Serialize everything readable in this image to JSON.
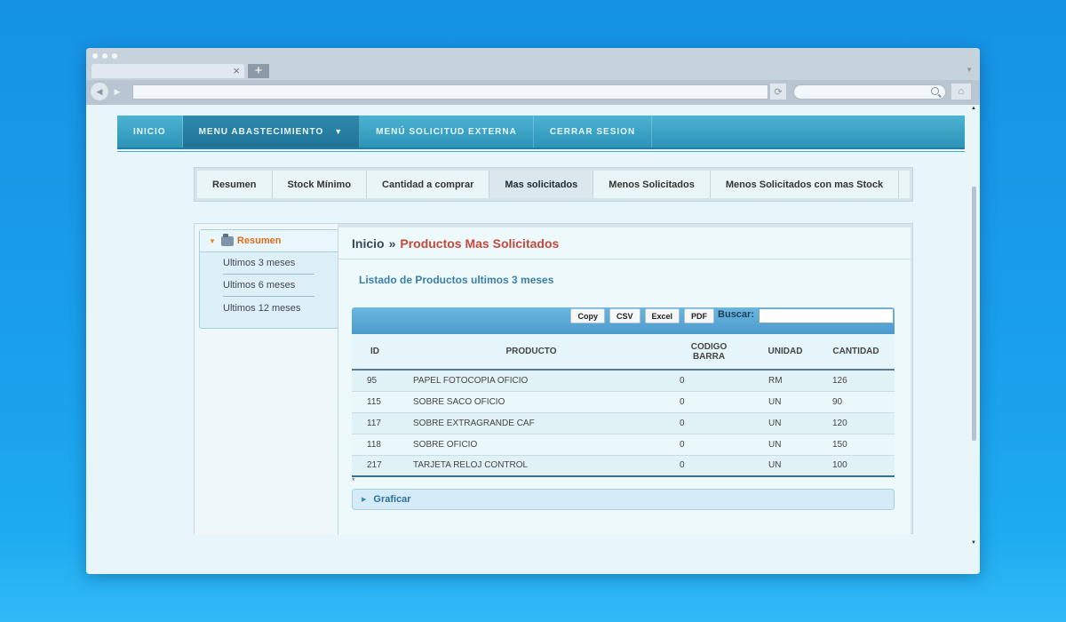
{
  "browser": {
    "tab_close": "×",
    "new_tab": "+",
    "back_glyph": "◀",
    "forward_glyph": "▶",
    "reload_glyph": "⟳",
    "home_glyph": "⌂",
    "tabs_menu_glyph": "▼"
  },
  "topnav": {
    "items": [
      {
        "label": "INICIO"
      },
      {
        "label": "MENU ABASTECIMIENTO",
        "caret": "▼",
        "active": true
      },
      {
        "label": "MENÚ SOLICITUD EXTERNA"
      },
      {
        "label": "CERRAR SESION"
      }
    ]
  },
  "subtabs": {
    "items": [
      {
        "label": "Resumen"
      },
      {
        "label": "Stock Mínimo"
      },
      {
        "label": "Cantidad a comprar"
      },
      {
        "label": "Mas solicitados",
        "active": true
      },
      {
        "label": "Menos Solicitados"
      },
      {
        "label": "Menos Solicitados con mas Stock"
      }
    ]
  },
  "sidebar": {
    "header_arrow": "▼",
    "title": "Resumen",
    "items": [
      {
        "label": "Ultimos 3 meses"
      },
      {
        "label": "Ultimos 6 meses"
      },
      {
        "label": "Ultimos 12 meses"
      }
    ]
  },
  "breadcrumb": {
    "home": "Inicio",
    "separator": "»",
    "current": "Productos Mas Solicitados"
  },
  "list_title": "Listado de Productos ultimos 3 meses",
  "table": {
    "toolbar": {
      "copy": "Copy",
      "csv": "CSV",
      "excel": "Excel",
      "pdf": "PDF",
      "search_label": "Buscar:",
      "search_value": ""
    },
    "headers": {
      "id": "ID",
      "producto": "PRODUCTO",
      "codigo_line1": "CODIGO",
      "codigo_line2": "BARRA",
      "unidad": "UNIDAD",
      "cantidad": "CANTIDAD"
    },
    "rows": [
      {
        "id": "95",
        "producto": "PAPEL FOTOCOPIA OFICIO",
        "codigo": "0",
        "unidad": "RM",
        "cantidad": "126"
      },
      {
        "id": "115",
        "producto": "SOBRE SACO OFICIO",
        "codigo": "0",
        "unidad": "UN",
        "cantidad": "90"
      },
      {
        "id": "117",
        "producto": "SOBRE EXTRAGRANDE CAF",
        "codigo": "0",
        "unidad": "UN",
        "cantidad": "120"
      },
      {
        "id": "118",
        "producto": "SOBRE OFICIO",
        "codigo": "0",
        "unidad": "UN",
        "cantidad": "150"
      },
      {
        "id": "217",
        "producto": "TARJETA RELOJ CONTROL",
        "codigo": "0",
        "unidad": "UN",
        "cantidad": "100"
      }
    ],
    "footnote": "*"
  },
  "graficar": {
    "arrow": "▶",
    "label": "Graficar"
  },
  "colors": {
    "accent": "#2d93b7",
    "breadcrumb_current": "#c24a3c",
    "sidebar_title": "#d96d1c",
    "list_title": "#3c7fa8"
  }
}
